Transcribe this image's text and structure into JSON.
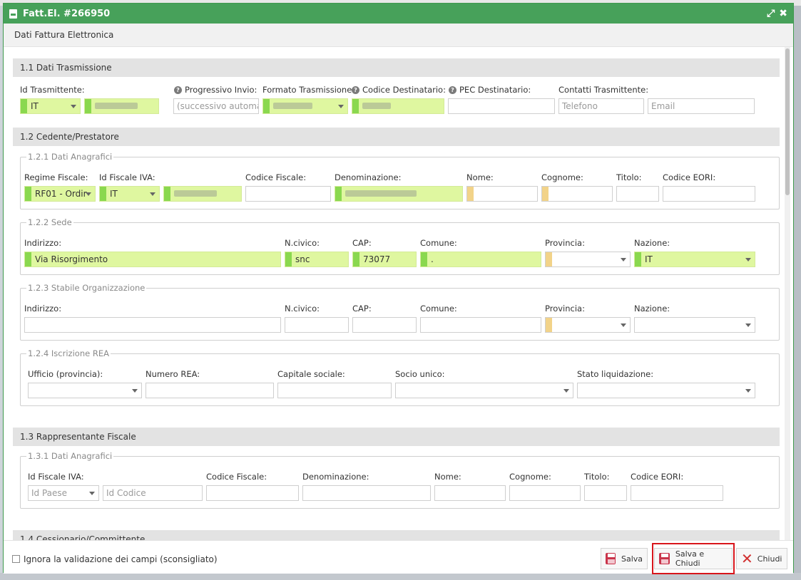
{
  "window": {
    "title": "Fatt.El. #266950",
    "header": "Dati Fattura Elettronica"
  },
  "s11": {
    "title": "1.1 Dati Trasmissione",
    "labels": {
      "id": "Id Trasmittente:",
      "prog": "Progressivo Invio:",
      "formato": "Formato Trasmissione:",
      "codice": "Codice Destinatario:",
      "pec": "PEC Destinatario:",
      "contatti": "Contatti Trasmittente:"
    },
    "id_country": "IT",
    "prog_placeholder": "(successivo automati",
    "tel_placeholder": "Telefono",
    "email_placeholder": "Email"
  },
  "s12": {
    "title": "1.2 Cedente/Prestatore",
    "anag": {
      "legend": "1.2.1 Dati Anagrafici",
      "labels": {
        "regime": "Regime Fiscale:",
        "idiva": "Id Fiscale IVA:",
        "cf": "Codice Fiscale:",
        "den": "Denominazione:",
        "nome": "Nome:",
        "cognome": "Cognome:",
        "titolo": "Titolo:",
        "eori": "Codice EORI:"
      },
      "regime_value": "RF01 - Ordir",
      "idiva_country": "IT"
    },
    "sede": {
      "legend": "1.2.2 Sede",
      "labels": {
        "ind": "Indirizzo:",
        "civ": "N.civico:",
        "cap": "CAP:",
        "com": "Comune:",
        "prov": "Provincia:",
        "naz": "Nazione:"
      },
      "indirizzo": "Via Risorgimento",
      "civico": "snc",
      "cap": "73077",
      "comune": ".",
      "nazione": "IT"
    },
    "stabile": {
      "legend": "1.2.3 Stabile Organizzazione",
      "labels": {
        "ind": "Indirizzo:",
        "civ": "N.civico:",
        "cap": "CAP:",
        "com": "Comune:",
        "prov": "Provincia:",
        "naz": "Nazione:"
      }
    },
    "rea": {
      "legend": "1.2.4 Iscrizione REA",
      "labels": {
        "uff": "Ufficio (provincia):",
        "num": "Numero REA:",
        "cap": "Capitale sociale:",
        "socio": "Socio unico:",
        "stato": "Stato liquidazione:"
      }
    }
  },
  "s13": {
    "title": "1.3 Rappresentante Fiscale",
    "anag": {
      "legend": "1.3.1 Dati Anagrafici",
      "labels": {
        "idiva": "Id Fiscale IVA:",
        "cf": "Codice Fiscale:",
        "den": "Denominazione:",
        "nome": "Nome:",
        "cognome": "Cognome:",
        "titolo": "Titolo:",
        "eori": "Codice EORI:"
      },
      "paese_placeholder": "Id Paese",
      "codice_placeholder": "Id Codice"
    }
  },
  "s14": {
    "title": "1.4 Cessionario/Committente"
  },
  "footer": {
    "ignore_label": "Ignora la validazione dei campi (sconsigliato)",
    "save": "Salva",
    "save_close": "Salva e Chiudi",
    "close": "Chiudi"
  }
}
